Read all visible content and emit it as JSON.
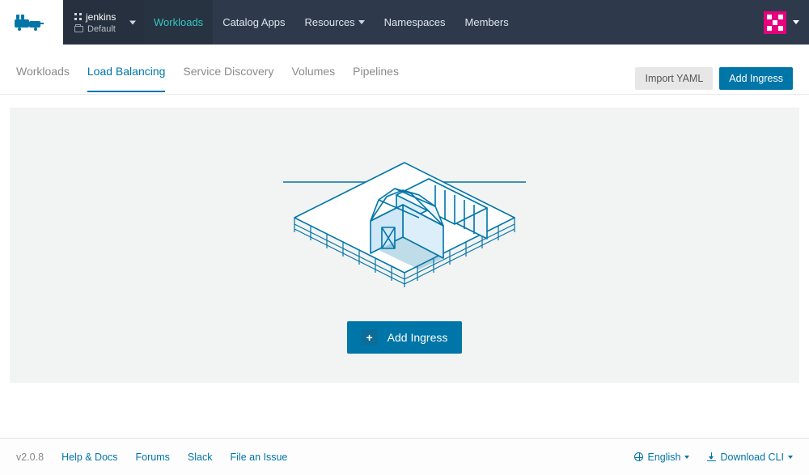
{
  "header": {
    "project_name": "jenkins",
    "namespace": "Default",
    "nav": [
      {
        "label": "Workloads",
        "active": true,
        "has_caret": false
      },
      {
        "label": "Catalog Apps",
        "active": false,
        "has_caret": false
      },
      {
        "label": "Resources",
        "active": false,
        "has_caret": true
      },
      {
        "label": "Namespaces",
        "active": false,
        "has_caret": false
      },
      {
        "label": "Members",
        "active": false,
        "has_caret": false
      }
    ]
  },
  "subtabs": {
    "items": [
      {
        "label": "Workloads",
        "active": false
      },
      {
        "label": "Load Balancing",
        "active": true
      },
      {
        "label": "Service Discovery",
        "active": false
      },
      {
        "label": "Volumes",
        "active": false
      },
      {
        "label": "Pipelines",
        "active": false
      }
    ],
    "import_label": "Import YAML",
    "add_label": "Add Ingress"
  },
  "empty_state": {
    "button_label": "Add Ingress"
  },
  "footer": {
    "version": "v2.0.8",
    "links": [
      {
        "label": "Help & Docs"
      },
      {
        "label": "Forums"
      },
      {
        "label": "Slack"
      },
      {
        "label": "File an Issue"
      }
    ],
    "language_label": "English",
    "download_label": "Download CLI"
  },
  "colors": {
    "primary": "#0075a8",
    "nav_bg": "#2e3a4b",
    "accent_teal": "#34c6c0",
    "avatar": "#e6007e"
  }
}
